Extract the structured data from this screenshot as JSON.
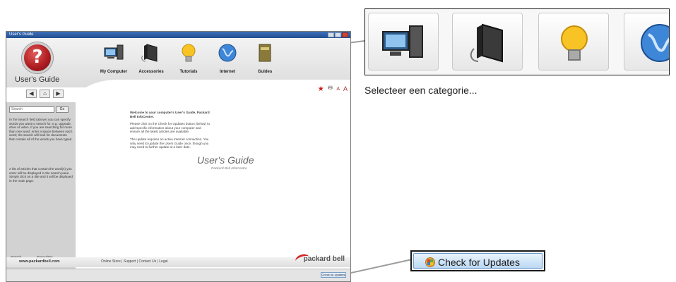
{
  "window": {
    "title": "User's Guide",
    "logo_title": "User's Guide",
    "categories": [
      {
        "label": "My Computer",
        "icon": "computer-icon"
      },
      {
        "label": "Accessories",
        "icon": "hard-drive-icon"
      },
      {
        "label": "Tutorials",
        "icon": "lightbulb-icon"
      },
      {
        "label": "Internet",
        "icon": "globe-icon"
      },
      {
        "label": "Guides",
        "icon": "books-icon"
      }
    ],
    "nav": {
      "back": "◀",
      "home": "⌂",
      "forward": "▶"
    },
    "sidebar": {
      "search_placeholder": "Search",
      "go_label": "Go",
      "help_text_1": "In the Search field (above) you can specify words you want to search for, e.g. upgrade, drive or video. If you are searching for more than one word, enter a space between each word; the search will look for documents that contain all of the words you have typed.",
      "help_text_2": "A list of articles that contain the word(s) you enter will be displayed in the search pane. Simply click on a title and it will be displayed in the main page.",
      "tab_search": "Search",
      "tab_favourites": "Favourites"
    },
    "tools": {
      "favourite": "★",
      "print": "🖶",
      "font_small": "A",
      "font_large": "A"
    },
    "welcome": {
      "heading": "Welcome to your computer's User's Guide, Packard Bell InfoCentre.",
      "para1": "Please click on the Check for Updates button (below) to add specific information about your computer and ensure all the latest articles are available.",
      "para2": "The update requires an active Internet connection. You only need to update the Users Guide once, though you may need to further update at a later date."
    },
    "big_title": "User's Guide",
    "big_subtitle": "Packard Bell InfoCentre",
    "footer": {
      "url": "www.packardbell.com",
      "links": "Online Store | Support | Contact Us | Legal",
      "brand": "packard bell"
    },
    "check_updates_small": "Check for Updates"
  },
  "callout": {
    "caption": "Selecteer een categorie...",
    "check_updates_label": "Check for Updates"
  },
  "colors": {
    "accent_red": "#c81e1e",
    "button_blue": "#6d9ad0"
  }
}
